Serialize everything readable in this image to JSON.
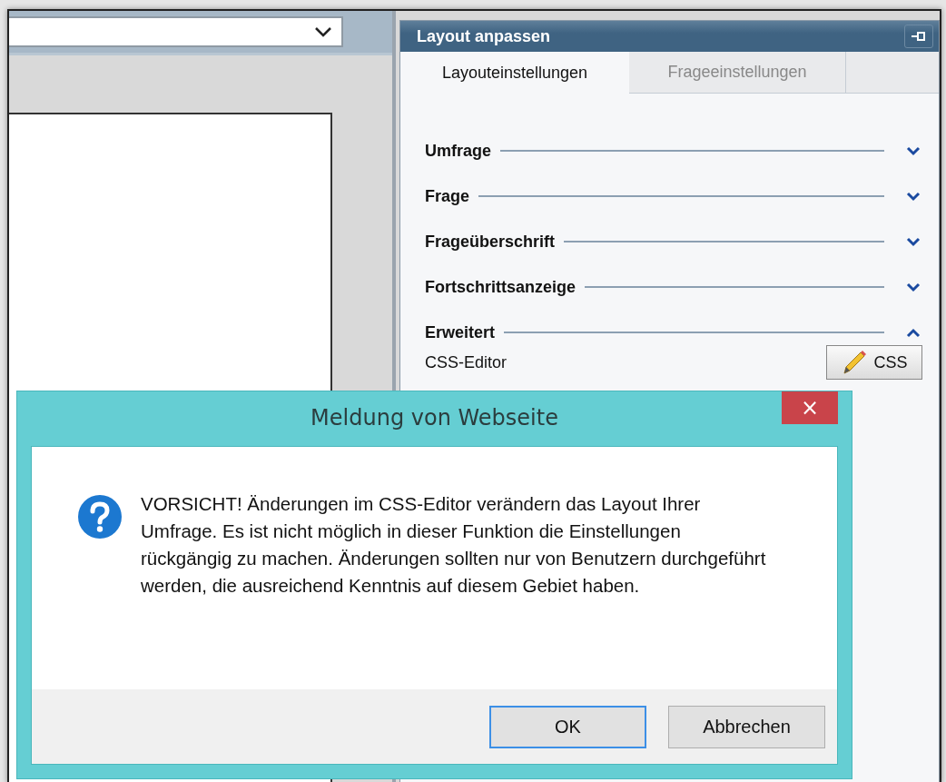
{
  "panel": {
    "title": "Layout anpassen"
  },
  "tabs": [
    {
      "label": "Layouteinstellungen",
      "selected": true
    },
    {
      "label": "Frageeinstellungen",
      "selected": false
    }
  ],
  "sections": [
    {
      "label": "Umfrage",
      "expanded": false
    },
    {
      "label": "Frage",
      "expanded": false
    },
    {
      "label": "Frageüberschrift",
      "expanded": false
    },
    {
      "label": "Fortschrittsanzeige",
      "expanded": false
    },
    {
      "label": "Erweitert",
      "expanded": true
    }
  ],
  "css_editor": {
    "label": "CSS-Editor",
    "button": "CSS"
  },
  "dialog": {
    "title": "Meldung von Webseite",
    "message": "VORSICHT! Änderungen im CSS-Editor verändern das Layout Ihrer Umfrage. Es ist nicht möglich in dieser Funktion die Einstellungen rückgängig zu machen. Änderungen sollten nur von Benutzern durchgeführt werden, die ausreichend Kenntnis auf diesem Gebiet haben.",
    "close": "×",
    "buttons": [
      {
        "label": "OK",
        "default": true
      },
      {
        "label": "Abbrechen",
        "default": false
      }
    ]
  }
}
